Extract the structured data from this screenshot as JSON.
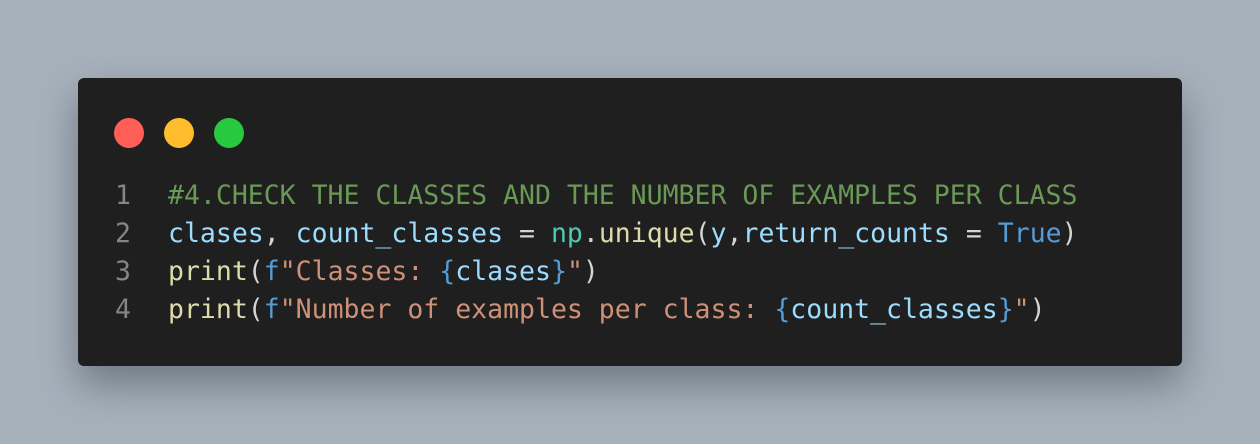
{
  "window_controls": {
    "close_color": "#ff5f56",
    "minimize_color": "#ffbd2e",
    "maximize_color": "#27c93f"
  },
  "code": {
    "lines": [
      {
        "number": "1",
        "tokens": [
          {
            "text": "#4.CHECK THE CLASSES AND THE NUMBER OF EXAMPLES PER CLASS",
            "type": "comment"
          }
        ]
      },
      {
        "number": "2",
        "tokens": [
          {
            "text": "clases",
            "type": "var"
          },
          {
            "text": ", ",
            "type": "plain"
          },
          {
            "text": "count_classes",
            "type": "var"
          },
          {
            "text": " = ",
            "type": "plain"
          },
          {
            "text": "np",
            "type": "class"
          },
          {
            "text": ".",
            "type": "plain"
          },
          {
            "text": "unique",
            "type": "func"
          },
          {
            "text": "(",
            "type": "plain"
          },
          {
            "text": "y",
            "type": "var"
          },
          {
            "text": ",",
            "type": "plain"
          },
          {
            "text": "return_counts",
            "type": "var"
          },
          {
            "text": " = ",
            "type": "plain"
          },
          {
            "text": "True",
            "type": "keyword"
          },
          {
            "text": ")",
            "type": "plain"
          }
        ]
      },
      {
        "number": "3",
        "tokens": [
          {
            "text": "print",
            "type": "func"
          },
          {
            "text": "(",
            "type": "plain"
          },
          {
            "text": "f",
            "type": "keyword"
          },
          {
            "text": "\"Classes: ",
            "type": "string"
          },
          {
            "text": "{",
            "type": "keyword"
          },
          {
            "text": "clases",
            "type": "var"
          },
          {
            "text": "}",
            "type": "keyword"
          },
          {
            "text": "\"",
            "type": "string"
          },
          {
            "text": ")",
            "type": "plain"
          }
        ]
      },
      {
        "number": "4",
        "tokens": [
          {
            "text": "print",
            "type": "func"
          },
          {
            "text": "(",
            "type": "plain"
          },
          {
            "text": "f",
            "type": "keyword"
          },
          {
            "text": "\"Number of examples per class: ",
            "type": "string"
          },
          {
            "text": "{",
            "type": "keyword"
          },
          {
            "text": "count_classes",
            "type": "var"
          },
          {
            "text": "}",
            "type": "keyword"
          },
          {
            "text": "\"",
            "type": "string"
          },
          {
            "text": ")",
            "type": "plain"
          }
        ]
      }
    ]
  }
}
